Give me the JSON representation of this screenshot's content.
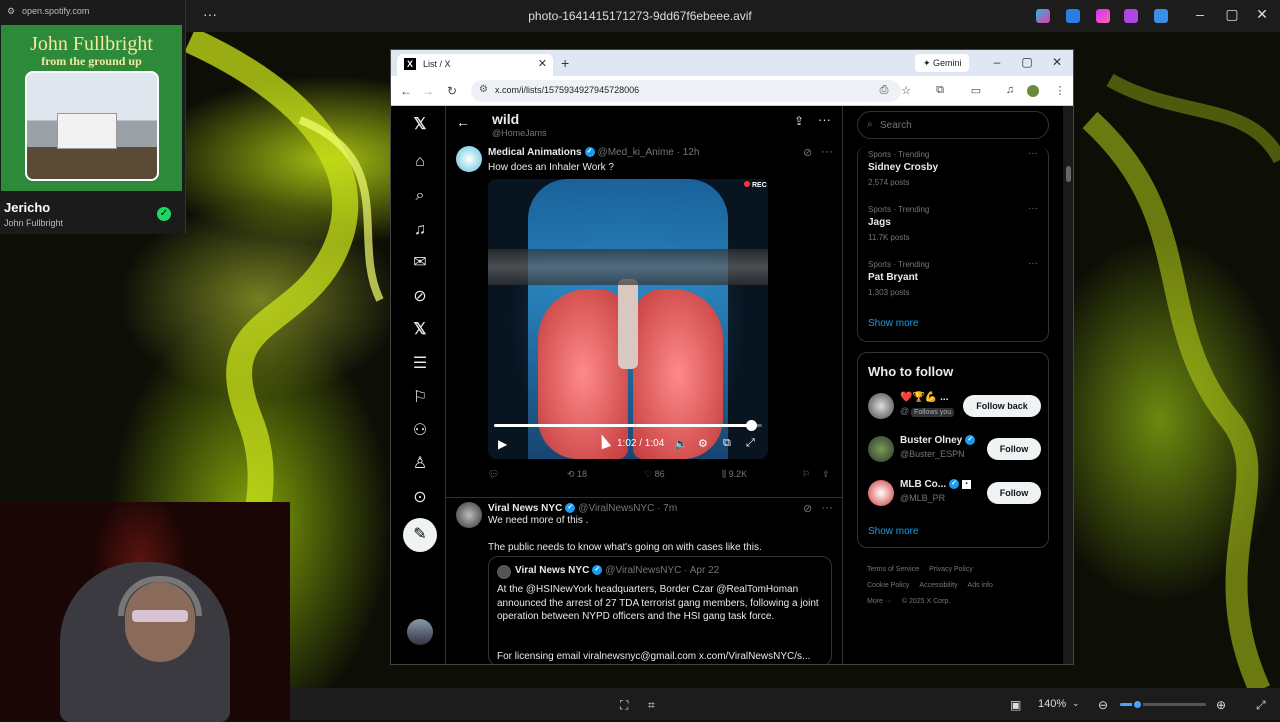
{
  "viewer": {
    "title": "photo-1641415171273-9dd67f6ebeee.avif",
    "more_label": "···",
    "zoom": "140%",
    "zoom_level": 0.2
  },
  "spotify": {
    "url": "open.spotify.com",
    "album_title": "John Fullbright",
    "album_subtitle": "from the ground up",
    "song": "Jericho",
    "artist": "John Fullbright"
  },
  "browser": {
    "tab_title": "List / X",
    "gemini_label": "Gemini",
    "url": "x.com/i/lists/1575934927945728006"
  },
  "list": {
    "name": "wild",
    "handle": "@HomeJams"
  },
  "tweets": [
    {
      "name": "Medical Animations",
      "handle": "@Med_ki_Anime · 12h",
      "text": "How does an Inhaler Work ?",
      "video": {
        "time": "1:02 / 1:04",
        "progress": 0.96,
        "rec_label": "REC"
      },
      "actions": {
        "replies": "",
        "retweets": "18",
        "likes": "86",
        "views": "9.2K"
      }
    },
    {
      "name": "Viral News NYC",
      "handle": "@ViralNewsNYC · 7m",
      "text_line1": "We need more of this .",
      "text_line2": "The public needs to know what's going on with cases like this.",
      "quote": {
        "name": "Viral News NYC",
        "handle": "@ViralNewsNYC · Apr 22",
        "text": "At the @HSINewYork headquarters, Border Czar @RealTomHoman announced the arrest of 27 TDA terrorist gang members, following a joint operation between NYPD officers and the HSI gang task force.",
        "footer": "For licensing email viralnewsnyc@gmail.com  x.com/ViralNewsNYC/s..."
      }
    }
  ],
  "search": {
    "placeholder": "Search"
  },
  "trends": [
    {
      "category": "Sports · Trending",
      "name": "Sidney Crosby",
      "count": "2,574 posts"
    },
    {
      "category": "Sports · Trending",
      "name": "Jags",
      "count": "11.7K posts"
    },
    {
      "category": "Sports · Trending",
      "name": "Pat Bryant",
      "count": "1,303 posts"
    }
  ],
  "show_more": "Show more",
  "who_to_follow": {
    "title": "Who to follow",
    "accounts": [
      {
        "name": "❤️🏆💪 ...",
        "handle": "@",
        "follows_you": "Follows you",
        "button": "Follow back"
      },
      {
        "name": "Buster Olney",
        "handle": "@Buster_ESPN",
        "button": "Follow"
      },
      {
        "name": "MLB Co...",
        "handle": "@MLB_PR",
        "button": "Follow"
      }
    ]
  },
  "footer": {
    "links": [
      "Terms of Service",
      "Privacy Policy",
      "Cookie Policy",
      "Accessibility",
      "Ads info",
      "More ···",
      "© 2025 X Corp."
    ]
  }
}
